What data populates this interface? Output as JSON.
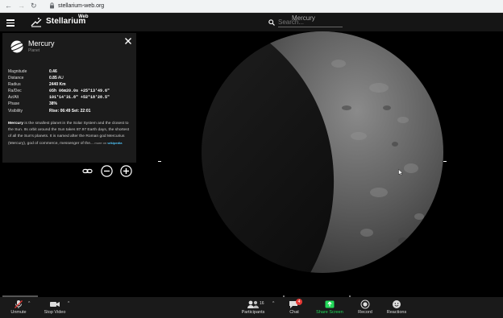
{
  "browser": {
    "url": "stellarium-web.org"
  },
  "app": {
    "logo_text": "Stellarium",
    "logo_sup": "Web",
    "search_placeholder": "Search...",
    "selected_title": "Mercury"
  },
  "info": {
    "name": "Mercury",
    "type": "Planet",
    "props": [
      {
        "key": "Magnitude",
        "value": "0.46",
        "unit": ""
      },
      {
        "key": "Distance",
        "value": "0.85",
        "unit": " AU"
      },
      {
        "key": "Radius",
        "value": "2440 Km",
        "unit": ""
      },
      {
        "key": "Ra/Dec",
        "value": "05h 06m20.0s  +25°13'49.6\"",
        "unit": "",
        "mono": true
      },
      {
        "key": "Az/Alt",
        "value": "101°14'31.8\"  +52°18'28.5\"",
        "unit": "",
        "mono": true
      },
      {
        "key": "Phase",
        "value": "38%",
        "unit": ""
      },
      {
        "key": "Visibility",
        "value": "Rise: 06:49   Set: 22:01",
        "unit": ""
      }
    ],
    "desc_bold": "Mercury",
    "desc_text": " is the smallest planet in the Solar System and the closest to the Sun. Its orbit around the Sun takes 87.97 Earth days, the shortest of all the Sun's planets. It is named after the Roman god Mercurius (Mercury), god of commerce, messenger of the...",
    "more_label": "more on",
    "wiki_label": "wikipedia"
  },
  "zoom": {
    "unmute": "Unmute",
    "stop_video": "Stop Video",
    "participants": "Participants",
    "participants_count": "16",
    "chat": "Chat",
    "chat_badge": "4",
    "share_screen": "Share Screen",
    "record": "Record",
    "reactions": "Reactions"
  },
  "colors": {
    "share_green": "#23d959",
    "wiki_link": "#4fc3f7",
    "panel_bg": "#1b1b1b"
  }
}
